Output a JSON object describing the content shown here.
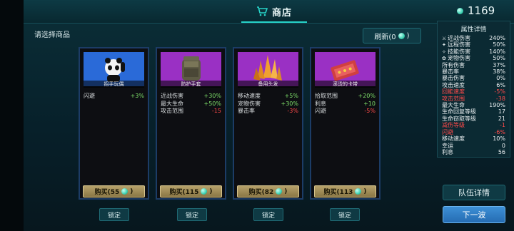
{
  "header": {
    "title": "商店",
    "coins": "1169"
  },
  "hint": "请选择商品",
  "refresh": {
    "label": "刷新(0"
  },
  "cards": [
    {
      "name": "招手玩偶",
      "bg": "#2060d0",
      "stats": [
        {
          "k": "闪避",
          "v": "+3%",
          "tone": "pos"
        }
      ],
      "buy": "购买(55",
      "lock": "锁定"
    },
    {
      "name": "防护手套",
      "bg": "#8a2ab8",
      "stats": [
        {
          "k": "近战伤害",
          "v": "+30%",
          "tone": "pos"
        },
        {
          "k": "最大生命",
          "v": "+50%",
          "tone": "pos"
        },
        {
          "k": "攻击范围",
          "v": "-15",
          "tone": "neg"
        }
      ],
      "buy": "购买(115",
      "lock": "锁定"
    },
    {
      "name": "备用头发",
      "bg": "#8a2ab8",
      "stats": [
        {
          "k": "移动速度",
          "v": "+5%",
          "tone": "pos"
        },
        {
          "k": "宠物伤害",
          "v": "+30%",
          "tone": "pos"
        },
        {
          "k": "暴击率",
          "v": "-3%",
          "tone": "neg"
        }
      ],
      "buy": "购买(82",
      "lock": "锁定"
    },
    {
      "name": "滚烫的卡带",
      "bg": "#8a2ab8",
      "stats": [
        {
          "k": "拾取范围",
          "v": "+20%",
          "tone": "pos"
        },
        {
          "k": "利息",
          "v": "+10",
          "tone": "pos"
        },
        {
          "k": "闪避",
          "v": "-5%",
          "tone": "neg"
        }
      ],
      "buy": "购买(113",
      "lock": "锁定"
    }
  ],
  "attributes": {
    "title": "属性详情",
    "rows": [
      {
        "k": "近战伤害",
        "v": "240%",
        "icon": "sword-icon",
        "red": false
      },
      {
        "k": "远程伤害",
        "v": "50%",
        "icon": "gun-icon",
        "red": false
      },
      {
        "k": "技能伤害",
        "v": "140%",
        "icon": "skill-icon",
        "red": false
      },
      {
        "k": "宠物伤害",
        "v": "50%",
        "icon": "pet-icon",
        "red": false
      },
      {
        "k": "所有伤害",
        "v": "37%",
        "red": false
      },
      {
        "k": "暴击率",
        "v": "38%",
        "red": false
      },
      {
        "k": "暴击伤害",
        "v": "0%",
        "red": false
      },
      {
        "k": "攻击速度",
        "v": "6%",
        "red": false
      },
      {
        "k": "回能速度",
        "v": "-5%",
        "red": true
      },
      {
        "k": "攻击范围",
        "v": "-38",
        "red": true
      },
      {
        "k": "最大生命",
        "v": "190%",
        "red": false
      },
      {
        "k": "生命回复等级",
        "v": "17",
        "red": false
      },
      {
        "k": "生命窃取等级",
        "v": "21",
        "red": false
      },
      {
        "k": "减伤等级",
        "v": "-1",
        "red": true
      },
      {
        "k": "闪避",
        "v": "-6%",
        "red": true
      },
      {
        "k": "移动速度",
        "v": "10%",
        "red": false
      },
      {
        "k": "幸运",
        "v": "0",
        "red": false
      },
      {
        "k": "利息",
        "v": "56",
        "red": false
      }
    ]
  },
  "buttons": {
    "team": "队伍详情",
    "next": "下一波"
  }
}
